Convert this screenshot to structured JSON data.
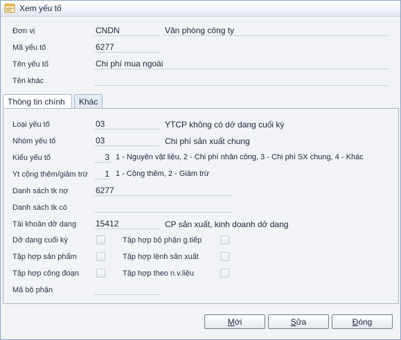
{
  "window": {
    "title": "Xem yếu tố"
  },
  "header": {
    "don_vi": {
      "label": "Đơn vị",
      "code": "CNDN",
      "name": "Văn phòng công ty"
    },
    "ma_yeu_to": {
      "label": "Mã yếu tố",
      "value": "6277"
    },
    "ten_yeu_to": {
      "label": "Tên yếu tố",
      "value": "Chi phí mua ngoài"
    },
    "ten_khac": {
      "label": "Tên khác",
      "value": ""
    }
  },
  "tabs": [
    {
      "label": "Thông tin chính"
    },
    {
      "label": "Khác"
    }
  ],
  "main": {
    "loai_yeu_to": {
      "label": "Loại yếu tố",
      "value": "03",
      "desc": "YTCP không có dở dang cuối kỳ"
    },
    "nhom_yeu_to": {
      "label": "Nhóm yếu tố",
      "value": "03",
      "desc": "Chi phí sản xuất chung"
    },
    "kieu_yeu_to": {
      "label": "Kiểu yếu tố",
      "value": "3",
      "desc": "1 - Nguyên vật liệu, 2 - Chi phí nhân công, 3 - Chi phí SX chung, 4 - Khác"
    },
    "yt_cong_them": {
      "label": "Yt cộng thêm/giảm trừ",
      "value": "1",
      "desc": "1 - Cộng thêm, 2 - Giảm trừ"
    },
    "ds_tk_no": {
      "label": "Danh sách tk nợ",
      "value": "6277"
    },
    "ds_tk_co": {
      "label": "Danh sách tk có",
      "value": ""
    },
    "tk_do_dang": {
      "label": "Tài khoản dở dang",
      "value": "15412",
      "desc": "CP sản xuất, kinh doanh dở dang"
    },
    "checks": {
      "do_dang_cuoi_ky": "Dở dang cuối kỳ",
      "tap_hop_bo_phan": "Tập hợp bộ phận g.tiếp",
      "tap_hop_san_pham": "Tập hợp sản phẩm",
      "tap_hop_lenh_sx": "Tập hợp lệnh sản xuất",
      "tap_hop_cong_doan": "Tập hợp công đoạn",
      "tap_hop_theo_nvl": "Tập hợp theo n.v.liệu"
    },
    "ma_bo_phan": {
      "label": "Mã bộ phận",
      "value": ""
    }
  },
  "buttons": {
    "new": {
      "pre": "",
      "key": "M",
      "post": "ới"
    },
    "edit": {
      "pre": "",
      "key": "S",
      "post": "ửa"
    },
    "close": {
      "pre": "",
      "key": "Đ",
      "post": "óng"
    }
  },
  "colors": {
    "accent": "#8aa2c2",
    "border": "#a7b7cc",
    "background": "#f1f3f6"
  }
}
